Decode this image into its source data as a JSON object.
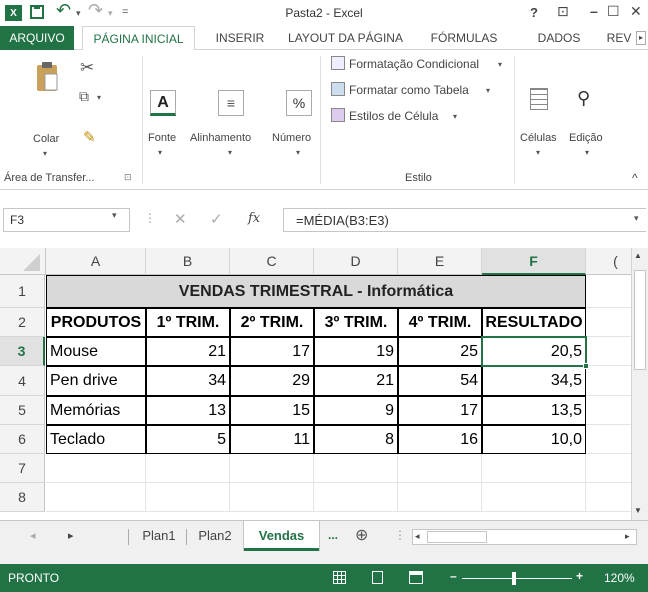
{
  "window": {
    "title": "Pasta2 - Excel",
    "help": "?",
    "restore_ribbon": "⊡",
    "minimize": "–",
    "maximize": "☐",
    "close": "✕",
    "app_icon": "X",
    "save_icon": "save-icon",
    "undo": "↶",
    "redo": "↷",
    "qat_dropdown": "=",
    "accent_color": "#217346"
  },
  "tabs": {
    "file": "ARQUIVO",
    "home": "PÁGINA INICIAL",
    "insert": "INSERIR",
    "layout": "LAYOUT DA PÁGINA",
    "formulas": "FÓRMULAS",
    "data": "DADOS",
    "review": "REV"
  },
  "ribbon": {
    "paste": "Colar",
    "clipboard_group": "Área de Transfer...",
    "font": "Fonte",
    "alignment": "Alinhamento",
    "number": "Número",
    "cond_format": "Formatação Condicional",
    "format_table": "Formatar como Tabela",
    "cell_styles": "Estilos de Célula",
    "style_group": "Estilo",
    "cells": "Células",
    "editing": "Edição",
    "launcher": "⊡",
    "collapse": "^"
  },
  "formula_bar": {
    "name_box": "F3",
    "cancel": "✕",
    "enter": "✓",
    "fx": "fx",
    "formula": "=MÉDIA(B3:E3)"
  },
  "grid": {
    "columns": [
      "A",
      "B",
      "C",
      "D",
      "E",
      "F",
      "("
    ],
    "rows": [
      "1",
      "2",
      "3",
      "4",
      "5",
      "6",
      "7",
      "8"
    ],
    "title": "VENDAS TRIMESTRAL - Informática",
    "headers": [
      "PRODUTOS",
      "1º TRIM.",
      "2º TRIM.",
      "3º TRIM.",
      "4º TRIM.",
      "RESULTADO"
    ],
    "data": [
      [
        "Mouse",
        "21",
        "17",
        "19",
        "25",
        "20,5"
      ],
      [
        "Pen drive",
        "34",
        "29",
        "21",
        "54",
        "34,5"
      ],
      [
        "Memórias",
        "13",
        "15",
        "9",
        "17",
        "13,5"
      ],
      [
        "Teclado",
        "5",
        "11",
        "8",
        "16",
        "10,0"
      ]
    ]
  },
  "sheets": {
    "tabs": [
      "Plan1",
      "Plan2",
      "Vendas"
    ],
    "active": "Vendas",
    "more": "...",
    "add": "⊕",
    "prev": "◂",
    "next": "▸"
  },
  "status": {
    "ready": "PRONTO",
    "zoom_minus": "–",
    "zoom_plus": "+",
    "zoom": "120%"
  }
}
